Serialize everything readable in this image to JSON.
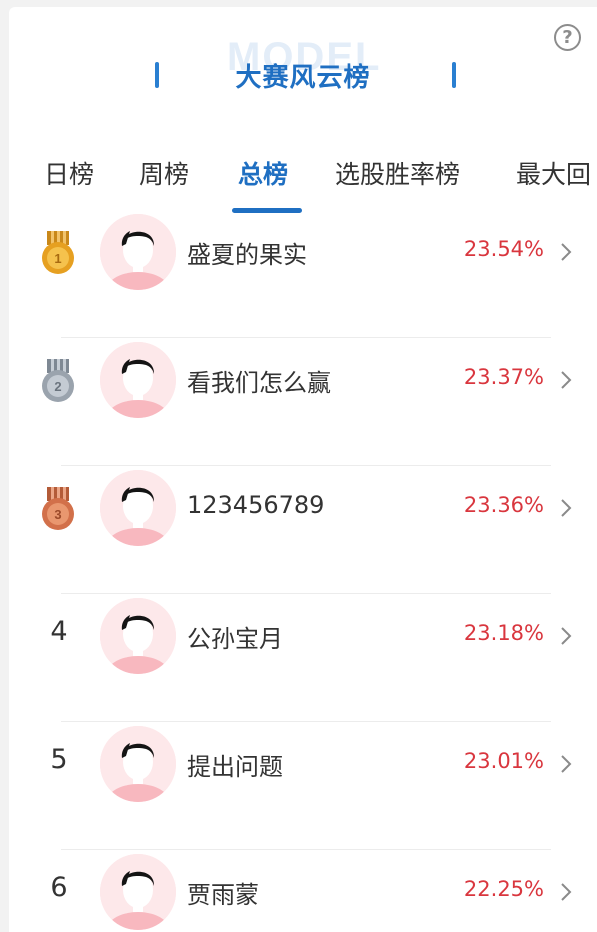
{
  "header": {
    "watermark": "MODEL",
    "title": "大赛风云榜",
    "help_icon": "?"
  },
  "tabs": [
    {
      "label": "日榜",
      "active": false
    },
    {
      "label": "周榜",
      "active": false
    },
    {
      "label": "总榜",
      "active": true
    },
    {
      "label": "选股胜率榜",
      "active": false
    },
    {
      "label": "最大回",
      "active": false
    }
  ],
  "colors": {
    "accent": "#1f6fc2",
    "rate_red": "#d9363e",
    "gold": "#e6a021",
    "silver": "#9aa3ad",
    "bronze": "#d2704a"
  },
  "rankings": [
    {
      "rank": "1",
      "medal": "gold",
      "name": "盛夏的果实",
      "rate": "23.54%"
    },
    {
      "rank": "2",
      "medal": "silver",
      "name": "看我们怎么赢",
      "rate": "23.37%"
    },
    {
      "rank": "3",
      "medal": "bronze",
      "name": "123456789",
      "rate": "23.36%"
    },
    {
      "rank": "4",
      "medal": "",
      "name": "公孙宝月",
      "rate": "23.18%"
    },
    {
      "rank": "5",
      "medal": "",
      "name": "提出问题",
      "rate": "23.01%"
    },
    {
      "rank": "6",
      "medal": "",
      "name": "贾雨蒙",
      "rate": "22.25%"
    }
  ]
}
